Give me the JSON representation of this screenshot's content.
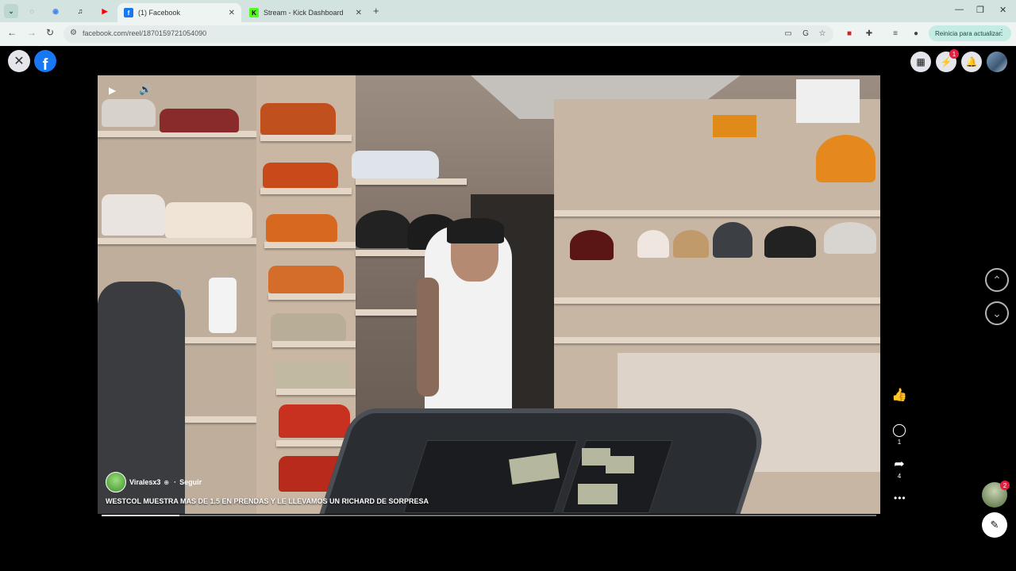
{
  "browser": {
    "tabs": [
      {
        "title": "(1) Facebook",
        "active": true,
        "favicon": "facebook-favicon"
      },
      {
        "title": "Stream - Kick Dashboard",
        "active": false,
        "favicon": "kick-favicon"
      }
    ],
    "pinned_icons": [
      "tab-search-icon",
      "generic-site-icon",
      "chrome-icon",
      "spotify-icon",
      "youtube-icon"
    ],
    "url": "facebook.com/reel/1870159721054090",
    "update_button": "Reinicia para actualizar"
  },
  "reel": {
    "author": "Viralesx3",
    "follow_label": "Seguir",
    "caption": "WESTCOL MUESTRA MAS DE 1.5 EN PRENDAS Y LE LLEVAMOS UN RICHARD DE SORPRESA",
    "progress": 0.1
  },
  "actions": {
    "comments": "1",
    "shares": "4"
  },
  "header": {
    "messenger_badge": "1",
    "side_avatar_badge": "2"
  },
  "colors": {
    "facebook_blue": "#1877f2",
    "notification_red": "#e41e3f",
    "chrome_tab_bar": "#d3e3e0"
  }
}
